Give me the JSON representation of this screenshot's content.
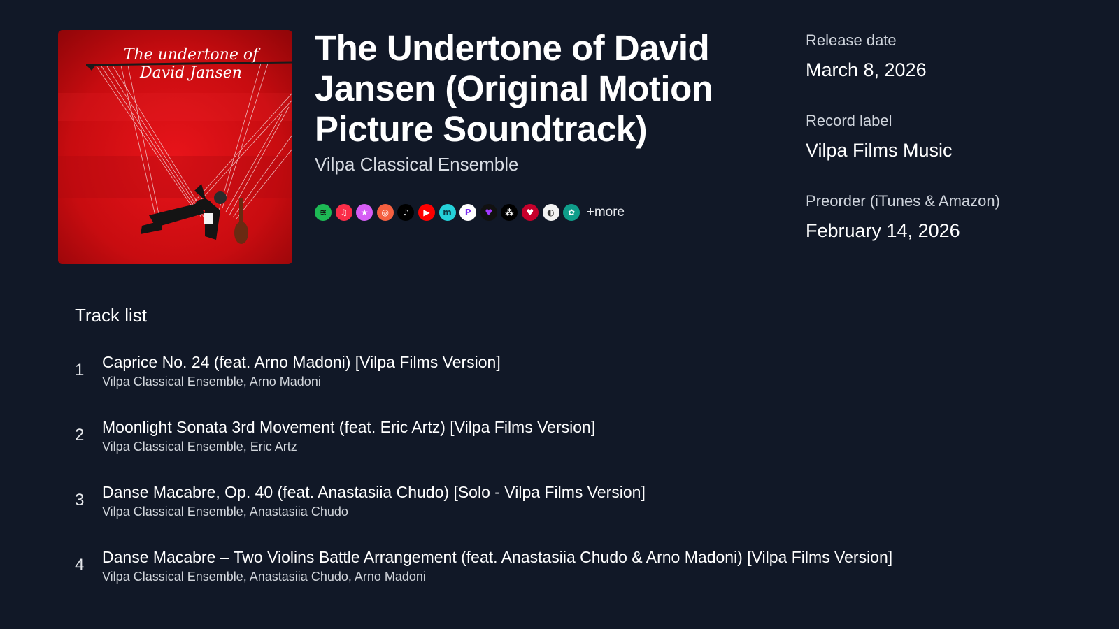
{
  "album": {
    "cover_title_line1": "The undertone of",
    "cover_title_line2": "David Jansen",
    "title": "The Undertone of David Jansen (Original Motion Picture Soundtrack)",
    "artist": "Vilpa Classical Ensemble"
  },
  "platforms": {
    "items": [
      {
        "name": "spotify-icon",
        "glyph": "≋",
        "bg": "#1db954",
        "fg": "#111111"
      },
      {
        "name": "apple-music-icon",
        "glyph": "♫",
        "bg": "#fa2d48",
        "fg": "#ffffff"
      },
      {
        "name": "itunes-store-icon",
        "glyph": "★",
        "bg": "#d65df5",
        "fg": "#ffffff"
      },
      {
        "name": "instagram-icon",
        "glyph": "◎",
        "bg": "#f56040",
        "fg": "#ffffff"
      },
      {
        "name": "tiktok-icon",
        "glyph": "♪",
        "bg": "#000000",
        "fg": "#ffffff"
      },
      {
        "name": "youtube-music-icon",
        "glyph": "▶",
        "bg": "#ff0000",
        "fg": "#ffffff"
      },
      {
        "name": "amazon-music-icon",
        "glyph": "m",
        "bg": "#25d1da",
        "fg": "#0b3b47"
      },
      {
        "name": "pandora-icon",
        "glyph": "P",
        "bg": "#ffffff",
        "fg": "#7b2cf0"
      },
      {
        "name": "deezer-icon",
        "glyph": "♥",
        "bg": "#111111",
        "fg": "#a238ff"
      },
      {
        "name": "tidal-icon",
        "glyph": "⁂",
        "bg": "#000000",
        "fg": "#ffffff"
      },
      {
        "name": "iheartradio-icon",
        "glyph": "♥",
        "bg": "#c6002b",
        "fg": "#ffffff"
      },
      {
        "name": "anghami-icon",
        "glyph": "◐",
        "bg": "#f2f2f2",
        "fg": "#333333"
      },
      {
        "name": "audiomack-icon",
        "glyph": "✿",
        "bg": "#0f9d8a",
        "fg": "#ffffff"
      }
    ],
    "more_label": "+more"
  },
  "meta": {
    "release_label": "Release date",
    "release_value": "March 8, 2026",
    "label_label": "Record label",
    "label_value": "Vilpa Films Music",
    "preorder_label": "Preorder (iTunes & Amazon)",
    "preorder_value": "February 14, 2026"
  },
  "tracklist": {
    "heading": "Track list",
    "tracks": [
      {
        "number": "1",
        "title": "Caprice No. 24 (feat. Arno Madoni) [Vilpa Films Version]",
        "artists": "Vilpa Classical Ensemble, Arno Madoni"
      },
      {
        "number": "2",
        "title": "Moonlight Sonata 3rd Movement (feat. Eric Artz) [Vilpa Films Version]",
        "artists": "Vilpa Classical Ensemble, Eric Artz"
      },
      {
        "number": "3",
        "title": "Danse Macabre, Op. 40 (feat. Anastasiia Chudo) [Solo - Vilpa Films Version]",
        "artists": "Vilpa Classical Ensemble, Anastasiia Chudo"
      },
      {
        "number": "4",
        "title": "Danse Macabre – Two Violins Battle Arrangement (feat. Anastasiia Chudo & Arno Madoni) [Vilpa Films Version]",
        "artists": "Vilpa Classical Ensemble, Anastasiia Chudo, Arno Madoni"
      }
    ]
  }
}
